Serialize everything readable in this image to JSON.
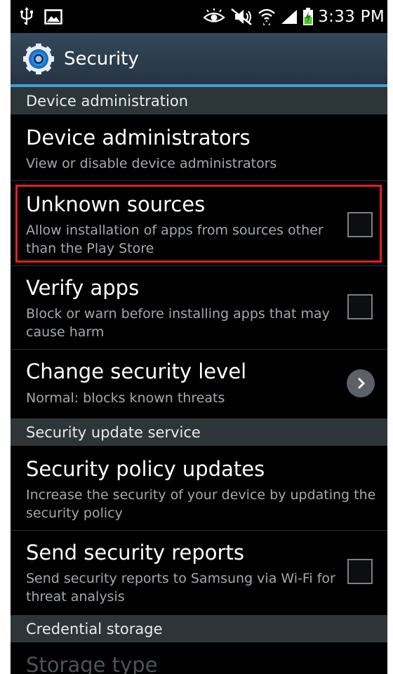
{
  "status_bar": {
    "time": "3:33 PM",
    "icons": [
      "usb-icon",
      "picture-icon",
      "smart-stay-eye-icon",
      "mute-icon",
      "wifi-icon",
      "signal-icon",
      "battery-charging-icon"
    ]
  },
  "action_bar": {
    "title": "Security",
    "icon": "gear-icon"
  },
  "colors": {
    "action_bar": "#2c3d4c",
    "accent_line": "#3aa0d8",
    "section_bg": "#2e3538",
    "highlight_border": "#e21e26",
    "subtitle": "#a3a9ae"
  },
  "sections": {
    "device_admin": {
      "header": "Device administration"
    },
    "update_service": {
      "header": "Security update service"
    },
    "credential": {
      "header": "Credential storage"
    }
  },
  "items": {
    "device_administrators": {
      "title": "Device administrators",
      "subtitle": "View or disable device administrators"
    },
    "unknown_sources": {
      "title": "Unknown sources",
      "subtitle": "Allow installation of apps from sources other than the Play Store",
      "checked": false
    },
    "verify_apps": {
      "title": "Verify apps",
      "subtitle": "Block or warn before installing apps that may cause harm",
      "checked": false
    },
    "change_security_level": {
      "title": "Change security level",
      "subtitle": "Normal: blocks known threats"
    },
    "security_policy_updates": {
      "title": "Security policy updates",
      "subtitle": "Increase the security of your device by updating the security policy"
    },
    "send_security_reports": {
      "title": "Send security reports",
      "subtitle": "Send security reports to Samsung via Wi-Fi for threat analysis",
      "checked": false
    },
    "storage_type": {
      "title": "Storage type"
    }
  }
}
